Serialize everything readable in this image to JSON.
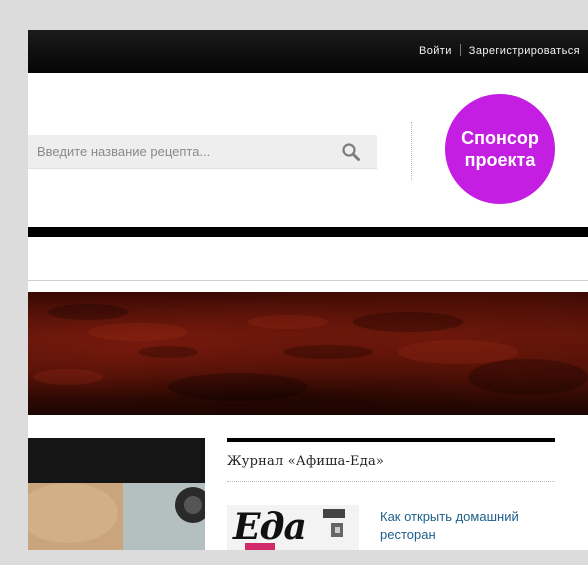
{
  "header": {
    "login": "Войти",
    "register": "Зарегистрироваться"
  },
  "search": {
    "placeholder": "Введите название рецепта...",
    "icon": "search-icon"
  },
  "sponsor": {
    "line1": "Спонсор",
    "line2": "проекта"
  },
  "journal": {
    "title": "Журнал «Афиша-Еда»",
    "magazine_logo": "Еда",
    "article": "Как открыть домашний ресторан"
  },
  "colors": {
    "topbar": "#0b0b0b",
    "sponsor": "#c41ee3",
    "link": "#1d5f8a",
    "banner": "#5c1409"
  }
}
